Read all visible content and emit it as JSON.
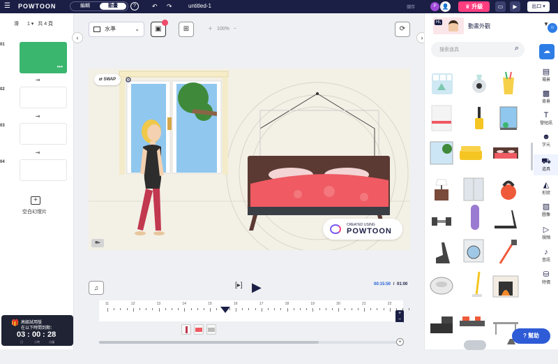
{
  "topbar": {
    "logo": "POWTOON",
    "toggle": [
      "編輯",
      "動畫"
    ],
    "help": "?",
    "title": "untitled-1",
    "save": "儲存",
    "avatar_initial": "P",
    "upgrade": "升級",
    "export": "出口"
  },
  "left": {
    "pager": {
      "prefix": "滑",
      "current": "1",
      "total": "共 4 頁"
    },
    "slide_numbers": [
      "01",
      "02",
      "03",
      "04"
    ],
    "add_label": "空白幻燈片"
  },
  "trial": {
    "line1": "高級試用版",
    "line2": "在以下時間到期：",
    "d": "03",
    "h": "00",
    "m": "28",
    "d_lbl": "日",
    "h_lbl": "小時",
    "m_lbl": "分鐘"
  },
  "canvas": {
    "orientation": "水準",
    "zoom": "100%",
    "swap": "SWAP",
    "watermark1": "CREATED USING",
    "watermark2": "POWTOON"
  },
  "timeline": {
    "current": "00:15:50",
    "total": "01:00",
    "ticks": [
      "11",
      "12",
      "13",
      "14",
      "15",
      "16",
      "17",
      "18",
      "19",
      "20",
      "21",
      "22"
    ]
  },
  "right": {
    "look_label": "動畫外觀",
    "look_hi": "Hi,",
    "search_placeholder": "搜索道具",
    "categories": [
      "場景",
      "背景",
      "發短訊",
      "字元",
      "道具",
      "形狀",
      "圖像",
      "視頻",
      "音訊",
      "特價"
    ],
    "help": "幫助"
  },
  "colors": {
    "brand": "#1b1f45",
    "accent": "#ff3d7f",
    "slide": "#3bb66f",
    "blue": "#2e7de6"
  }
}
